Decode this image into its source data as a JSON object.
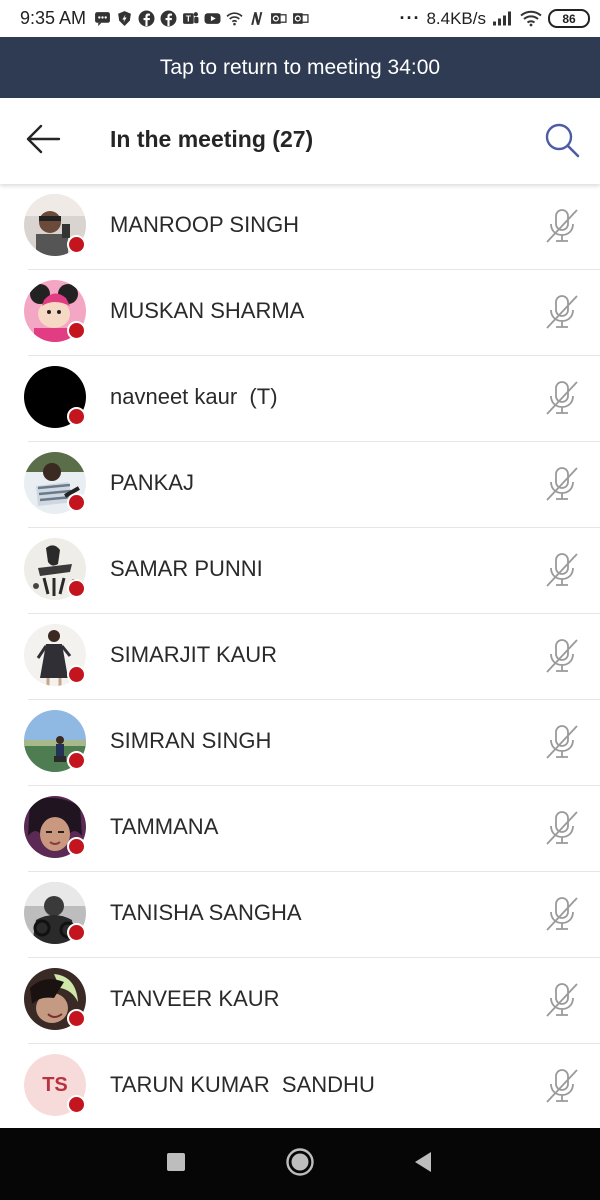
{
  "status_bar": {
    "time": "9:35 AM",
    "net_speed": "8.4KB/s",
    "battery": "86",
    "more": "···",
    "notification_icons": [
      "message-icon",
      "shield-icon",
      "facebook-icon",
      "facebook-icon",
      "teams-icon",
      "youtube-icon",
      "wifi-icon",
      "n-icon",
      "outlook-icon",
      "outlook-icon"
    ]
  },
  "banner": {
    "text": "Tap to return to meeting 34:00"
  },
  "header": {
    "title": "In the meeting (27)",
    "back_icon": "arrow-left-icon",
    "search_icon": "search-icon"
  },
  "colors": {
    "banner_bg": "#2f3b52",
    "presence_busy": "#c4141e",
    "search_accent": "#4d5ca5",
    "initials_bg": "#f7dada",
    "initials_fg": "#b8333d"
  },
  "participants": [
    {
      "name": "MANROOP SINGH",
      "avatar": "photo",
      "status": "busy",
      "muted": true
    },
    {
      "name": "MUSKAN SHARMA",
      "avatar": "photo",
      "status": "busy",
      "muted": true
    },
    {
      "name": "navneet kaur  (T)",
      "avatar": "photo",
      "status": "busy",
      "muted": true
    },
    {
      "name": "PANKAJ",
      "avatar": "photo",
      "status": "busy",
      "muted": true
    },
    {
      "name": "SAMAR PUNNI",
      "avatar": "photo",
      "status": "busy",
      "muted": true
    },
    {
      "name": "SIMARJIT KAUR",
      "avatar": "photo",
      "status": "busy",
      "muted": true
    },
    {
      "name": "SIMRAN SINGH",
      "avatar": "photo",
      "status": "busy",
      "muted": true
    },
    {
      "name": "TAMMANA",
      "avatar": "photo",
      "status": "busy",
      "muted": true
    },
    {
      "name": "TANISHA SANGHA",
      "avatar": "photo",
      "status": "busy",
      "muted": true
    },
    {
      "name": "TANVEER KAUR",
      "avatar": "photo",
      "status": "busy",
      "muted": true
    },
    {
      "name": "TARUN KUMAR  SANDHU",
      "avatar": "initials",
      "initials": "TS",
      "status": "busy",
      "muted": true
    }
  ],
  "nav_bar": {
    "buttons": [
      "recents-square-icon",
      "home-circle-icon",
      "back-triangle-icon"
    ]
  }
}
